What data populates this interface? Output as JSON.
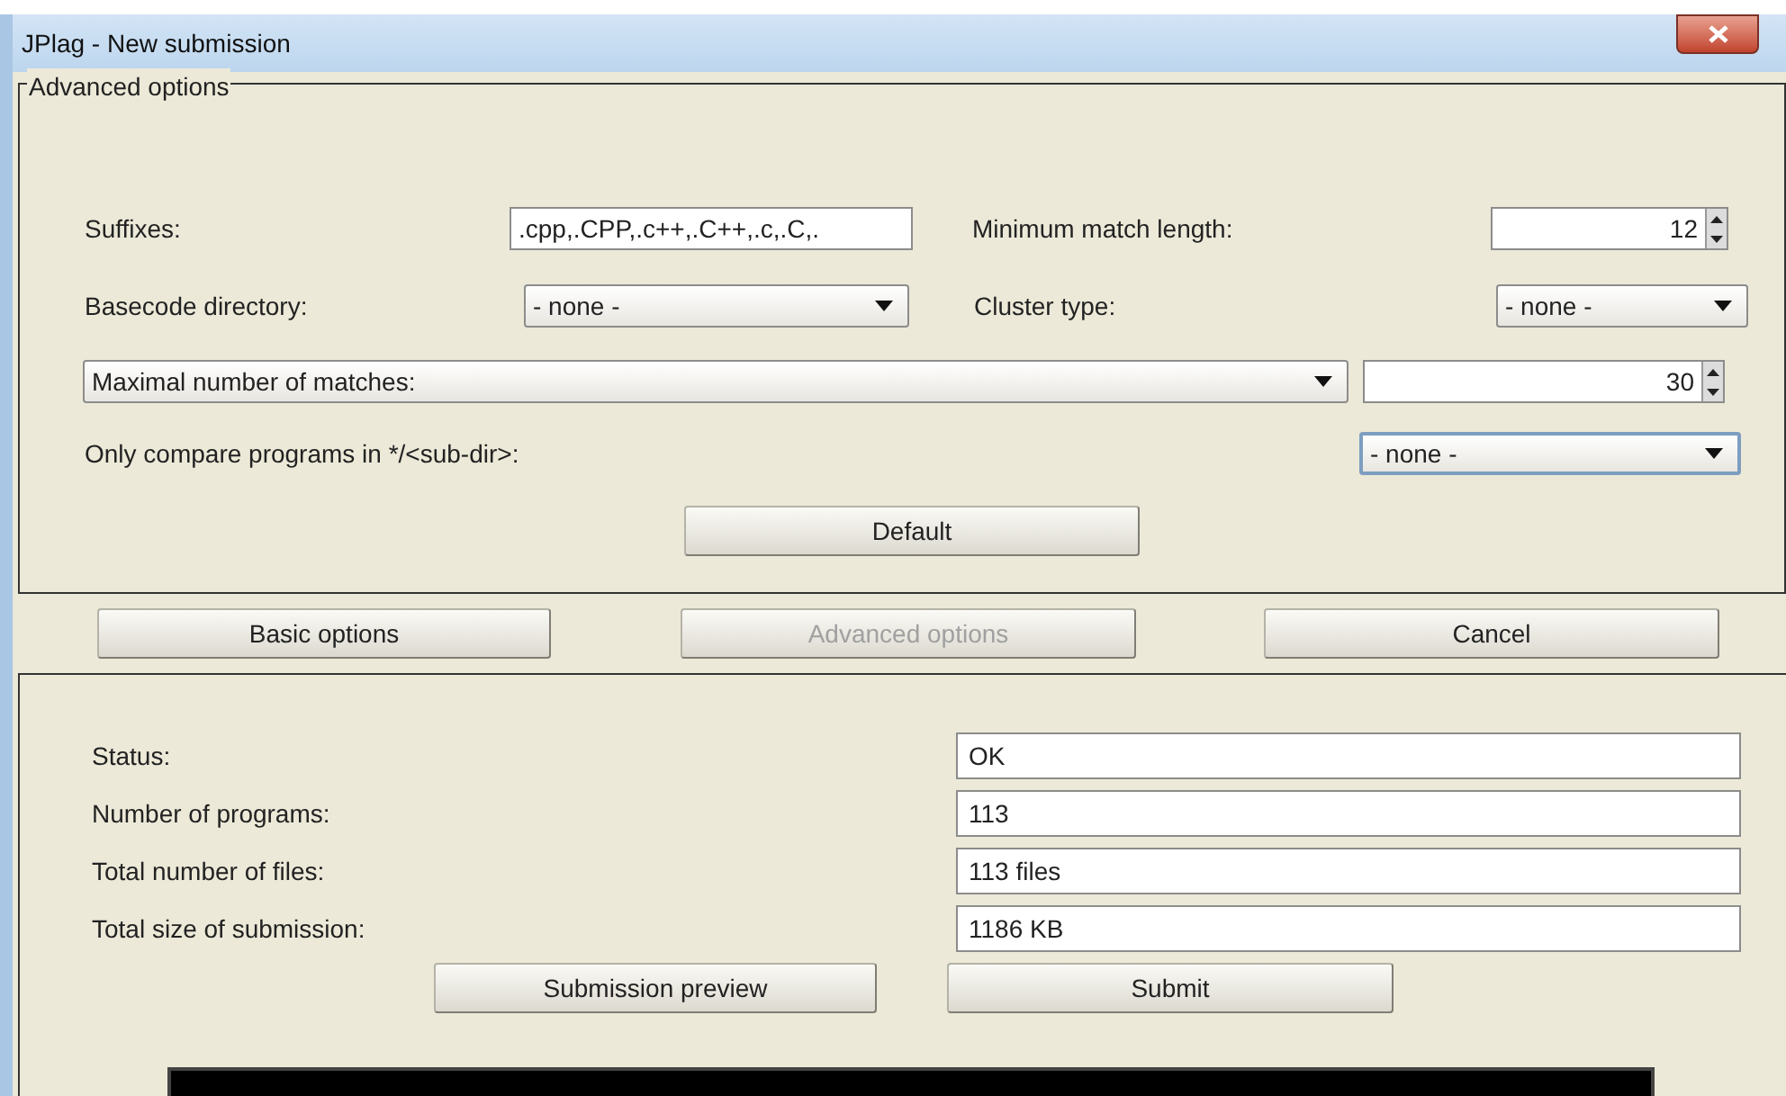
{
  "window": {
    "title": "JPlag - New submission"
  },
  "advanced_options": {
    "legend": "Advanced options",
    "suffixes": {
      "label": "Suffixes:",
      "value": ".cpp,.CPP,.c++,.C++,.c,.C,."
    },
    "min_match": {
      "label": "Minimum match length:",
      "value": "12"
    },
    "basecode": {
      "label": "Basecode directory:",
      "value": "- none -"
    },
    "cluster": {
      "label": "Cluster type:",
      "value": "- none -"
    },
    "max_matches": {
      "value": "Maximal number of matches:",
      "count": "30"
    },
    "subdir": {
      "label": "Only compare programs in */<sub-dir>:",
      "value": "- none -",
      "focused": true
    },
    "default_button": "Default"
  },
  "buttons": [
    {
      "label": "Basic options",
      "disabled": false
    },
    {
      "label": "Advanced options",
      "disabled": true
    },
    {
      "label": "Cancel",
      "disabled": false
    }
  ],
  "summary": [
    {
      "label": "Status:",
      "value": "OK"
    },
    {
      "label": "Number of programs:",
      "value": "113"
    },
    {
      "label": "Total number of files:",
      "value": "113 files"
    },
    {
      "label": "Total size of submission:",
      "value": "1186 KB"
    }
  ],
  "actions": [
    "Submission preview",
    "Submit"
  ]
}
